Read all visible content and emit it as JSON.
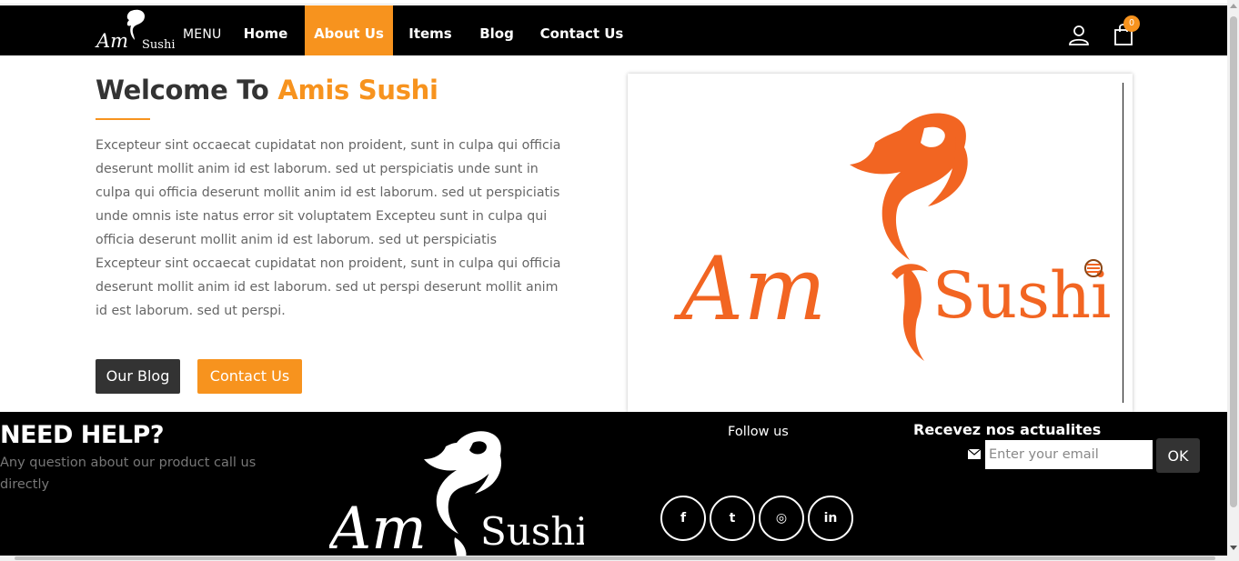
{
  "nav": {
    "logo_text_script": "Am",
    "logo_text_sushi": "Sushi",
    "menu_label": "MENU",
    "items": [
      {
        "label": "Home",
        "active": false
      },
      {
        "label": "About Us",
        "active": true
      },
      {
        "label": "Items",
        "active": false
      },
      {
        "label": "Blog",
        "active": false
      },
      {
        "label": "Contact Us",
        "active": false
      }
    ],
    "user_icon": "user-icon",
    "cart_icon": "shopping-bag-icon",
    "cart_count": "0"
  },
  "main": {
    "title_prefix": "Welcome To ",
    "title_accent": "Amis Sushi",
    "body": "Excepteur sint occaecat cupidatat non proident, sunt in culpa qui officia deserunt mollit anim id est laborum. sed ut perspiciatis unde sunt in culpa qui officia deserunt mollit anim id est laborum. sed ut perspiciatis unde omnis iste natus error sit voluptatem Excepteu sunt in culpa qui officia deserunt mollit anim id est laborum. sed ut perspiciatis Excepteur sint occaecat cupidatat non proident, sunt in culpa qui officia deserunt mollit anim id est laborum. sed ut perspi deserunt mollit anim id est laborum. sed ut perspi.",
    "blog_button": "Our Blog",
    "contact_button": "Contact Us",
    "logo_text_script": "Am",
    "logo_text_sushi": "Sushi"
  },
  "footer": {
    "need_help": "NEED HELP?",
    "need_help_sub": "Any question about our product call us directly",
    "logo_text_script": "Am",
    "logo_text_sushi": "Sushi",
    "follow_label": "Follow us",
    "social": [
      {
        "icon": "facebook-icon",
        "glyph": "f"
      },
      {
        "icon": "twitter-icon",
        "glyph": "t"
      },
      {
        "icon": "instagram-icon",
        "glyph": "◎"
      },
      {
        "icon": "linkedin-icon",
        "glyph": "in"
      }
    ],
    "newsletter_title": "Recevez nos actualites",
    "email_placeholder": "Enter your email",
    "email_value": "",
    "ok_button": "OK"
  },
  "colors": {
    "accent": "#f7931e",
    "logo_orange": "#f26522",
    "dark": "#333333",
    "black": "#000000"
  }
}
